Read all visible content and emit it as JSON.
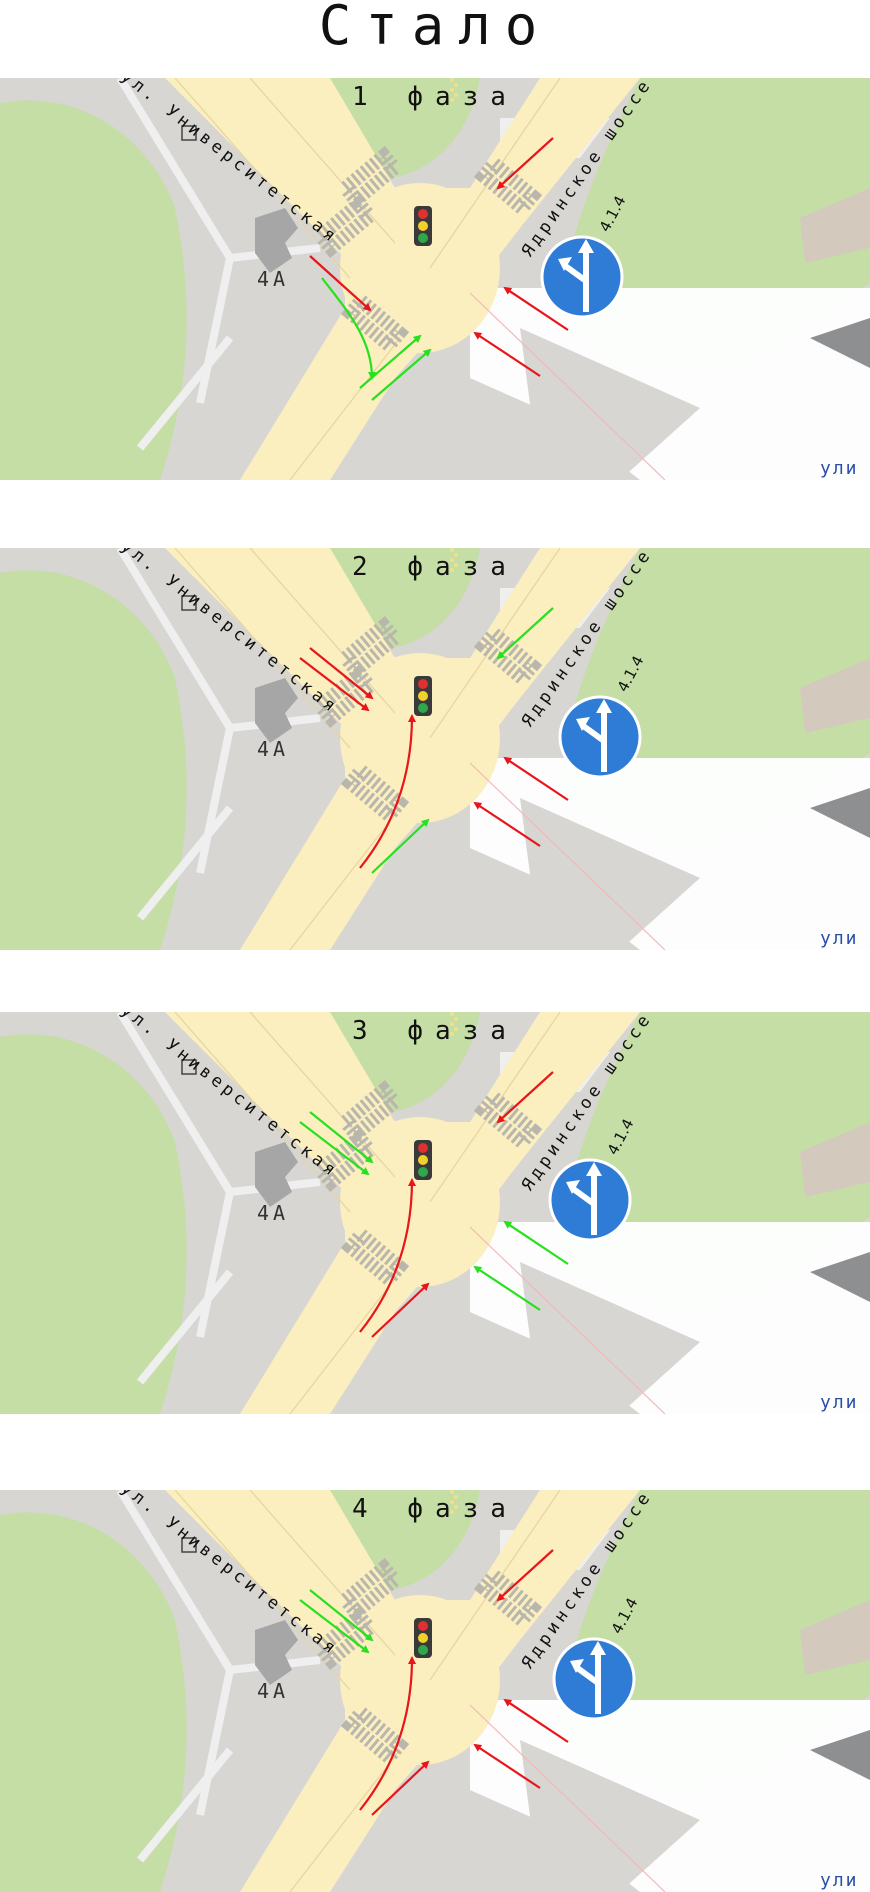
{
  "title": "Стало",
  "labels": {
    "street_left": "ул. Университетская",
    "street_right": "Ядринское шоссе",
    "building": "4А",
    "street_bottom": "ули",
    "sign": "4.1.4"
  },
  "colors": {
    "red": "#e8151b",
    "green": "#28e020",
    "road": "#fbefbf",
    "grass": "#c5dea6",
    "gray": "#d7d6d3",
    "sign_blue": "#2f7cd7"
  },
  "phases": [
    {
      "label": "1 фаза",
      "green": [
        "left-turn-u",
        "right-up-a",
        "right-up-b"
      ],
      "red": [
        "left-straight",
        "top-right-in",
        "bottom-right-in-a",
        "bottom-right-in-b"
      ]
    },
    {
      "label": "2 фаза",
      "green": [
        "top-right-in",
        "bottom-left-straight"
      ],
      "red": [
        "left-double",
        "bottom-left-turn",
        "bottom-right-in-a",
        "bottom-right-in-b"
      ]
    },
    {
      "label": "3 фаза",
      "green": [
        "left-double",
        "bottom-right-in-a",
        "bottom-right-in-b"
      ],
      "red": [
        "top-right-in",
        "bottom-left-turn",
        "bottom-left-straight"
      ]
    },
    {
      "label": "4 фаза",
      "green": [
        "left-double"
      ],
      "red": [
        "top-right-in",
        "bottom-left-turn",
        "bottom-left-straight",
        "bottom-right-in-a",
        "bottom-right-in-b"
      ]
    }
  ]
}
